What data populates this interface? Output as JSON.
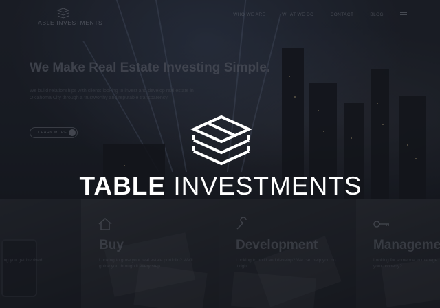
{
  "logo": {
    "small_text": "TABLE INVESTMENTS"
  },
  "nav": {
    "items": [
      "WHO WE ARE",
      "WHAT WE DO",
      "CONTACT",
      "BLOG"
    ],
    "menu_icon": "hamburger-menu-icon"
  },
  "hero": {
    "title": "We Make Real Estate Investing Simple.",
    "subtitle": "We build relationships with clients looking to invest and develop real estate in Oklahoma City through a trustworthy and reputable transparency.",
    "button_label": "LEARN MORE"
  },
  "services": [
    {
      "name": "",
      "description": "ing you get involved",
      "icon": "phone-image"
    },
    {
      "name": "Buy",
      "description": "Looking to grow your real estate portfolio? We'll guide you through it every step.",
      "icon": "house-icon"
    },
    {
      "name": "Development",
      "description": "Looking to build and develop? We can help you do it right.",
      "icon": "wrench-icon"
    },
    {
      "name": "Management",
      "description": "Looking for someone to manage your property?",
      "icon": "key-icon"
    }
  ],
  "brand": {
    "word_bold": "TABLE",
    "word_light": "INVESTMENTS"
  },
  "colors": {
    "overlay": "#12141a",
    "brand_text": "#ffffff"
  }
}
